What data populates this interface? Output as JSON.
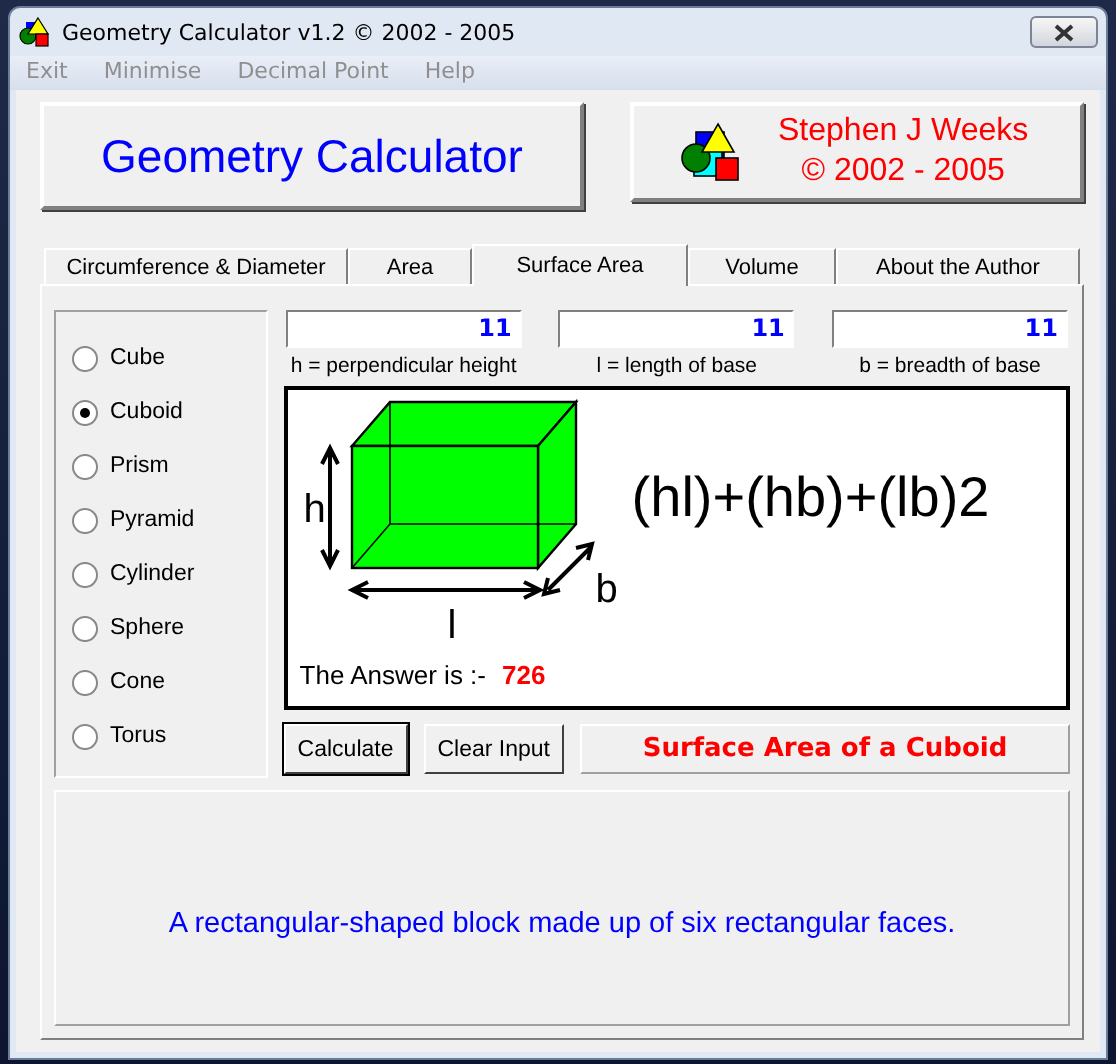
{
  "window": {
    "title": "Geometry Calculator v1.2 ©  2002 - 2005"
  },
  "menu": [
    "Exit",
    "Minimise",
    "Decimal Point",
    "Help"
  ],
  "header": {
    "title": "Geometry Calculator",
    "author": "Stephen J Weeks",
    "copyright": "© 2002 - 2005"
  },
  "tabs": [
    {
      "label": "Circumference & Diameter",
      "selected": false
    },
    {
      "label": "Area",
      "selected": false
    },
    {
      "label": "Surface Area",
      "selected": true
    },
    {
      "label": "Volume",
      "selected": false
    },
    {
      "label": "About the Author",
      "selected": false
    }
  ],
  "shapes": [
    {
      "label": "Cube",
      "selected": false
    },
    {
      "label": "Cuboid",
      "selected": true
    },
    {
      "label": "Prism",
      "selected": false
    },
    {
      "label": "Pyramid",
      "selected": false
    },
    {
      "label": "Cylinder",
      "selected": false
    },
    {
      "label": "Sphere",
      "selected": false
    },
    {
      "label": "Cone",
      "selected": false
    },
    {
      "label": "Torus",
      "selected": false
    }
  ],
  "inputs": [
    {
      "value": "11",
      "label": "h = perpendicular height"
    },
    {
      "value": "11",
      "label": "l = length of base"
    },
    {
      "value": "11",
      "label": "b = breadth of base"
    }
  ],
  "diagram": {
    "h_label": "h",
    "l_label": "l",
    "b_label": "b",
    "formula": "(hl)+(hb)+(lb)2",
    "answer_label": "The Answer is :-",
    "answer": "726"
  },
  "buttons": [
    "Calculate",
    "Clear Input"
  ],
  "result_title": "Surface Area of a Cuboid",
  "description": "A rectangular-shaped block made up of six rectangular faces."
}
